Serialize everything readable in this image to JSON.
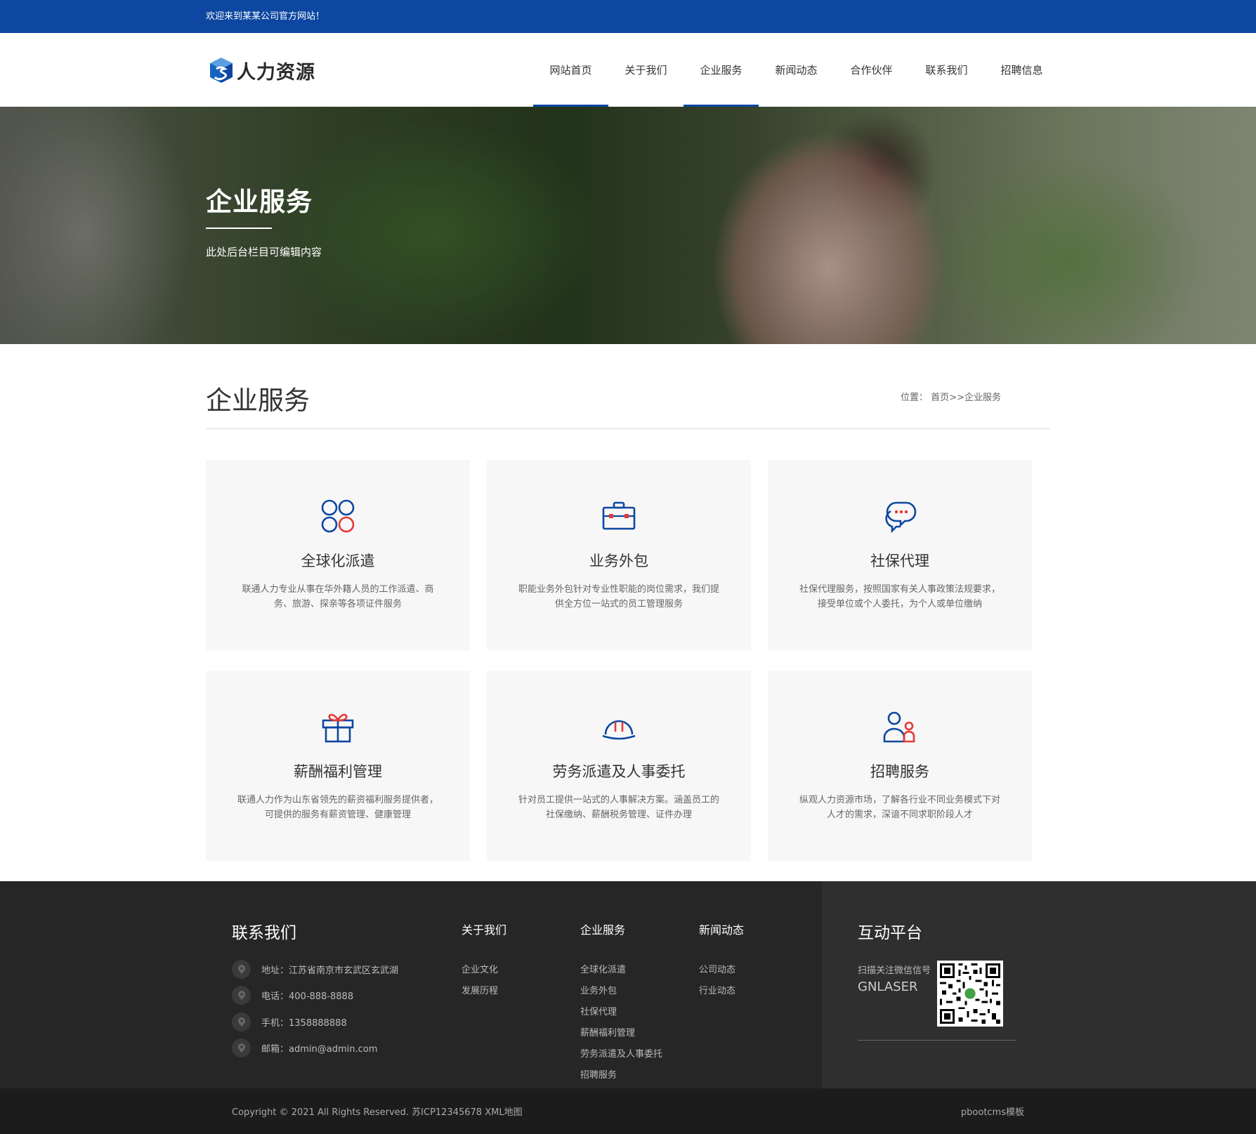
{
  "topbar": {
    "welcome": "欢迎来到某某公司官方网站！"
  },
  "header": {
    "logo_text": "人力资源",
    "nav": [
      {
        "label": "网站首页",
        "active": true
      },
      {
        "label": "关于我们",
        "active": false
      },
      {
        "label": "企业服务",
        "active": true
      },
      {
        "label": "新闻动态",
        "active": false
      },
      {
        "label": "合作伙伴",
        "active": false
      },
      {
        "label": "联系我们",
        "active": false
      },
      {
        "label": "招聘信息",
        "active": false
      }
    ]
  },
  "banner": {
    "title": "企业服务",
    "subtitle": "此处后台栏目可编辑内容"
  },
  "section": {
    "title": "企业服务",
    "breadcrumb_label": "位置：",
    "breadcrumb_home": "首页",
    "breadcrumb_sep": ">>",
    "breadcrumb_current": "企业服务"
  },
  "services": [
    {
      "icon": "clover-icon",
      "title": "全球化派遣",
      "desc": "联通人力专业从事在华外籍人员的工作派遣、商务、旅游、探亲等各项证件服务"
    },
    {
      "icon": "briefcase-icon",
      "title": "业务外包",
      "desc": "职能业务外包针对专业性职能的岗位需求，我们提供全方位一站式的员工管理服务"
    },
    {
      "icon": "chat-bubbles-icon",
      "title": "社保代理",
      "desc": "社保代理服务，按照国家有关人事政策法规要求，接受单位或个人委托，为个人或单位缴纳"
    },
    {
      "icon": "gift-icon",
      "title": "薪酬福利管理",
      "desc": "联通人力作为山东省领先的薪资福利服务提供者，可提供的服务有薪资管理、健康管理"
    },
    {
      "icon": "hard-hat-icon",
      "title": "劳务派遣及人事委托",
      "desc": "针对员工提供一站式的人事解决方案。涵盖员工的社保缴纳、薪酬税务管理、证件办理"
    },
    {
      "icon": "people-icon",
      "title": "招聘服务",
      "desc": "纵观人力资源市场，了解各行业不同业务模式下对人才的需求，深谙不同求职阶段人才"
    }
  ],
  "footer": {
    "contact_title": "联系我们",
    "contacts": [
      "地址：江苏省南京市玄武区玄武湖",
      "电话：400-888-8888",
      "手机：1358888888",
      "邮箱：admin@admin.com"
    ],
    "columns": [
      {
        "title": "关于我们",
        "links": [
          "企业文化",
          "发展历程"
        ]
      },
      {
        "title": "企业服务",
        "links": [
          "全球化派遣",
          "业务外包",
          "社保代理",
          "薪酬福利管理",
          "劳务派遣及人事委托",
          "招聘服务"
        ]
      },
      {
        "title": "新闻动态",
        "links": [
          "公司动态",
          "行业动态"
        ]
      }
    ],
    "interactive_title": "互动平台",
    "wechat_label": "扫描关注微信信号",
    "wechat_id": "GNLASER"
  },
  "bottom": {
    "copyright": "Copyright © 2021 All Rights Reserved. 苏ICP12345678",
    "sitemap": "XML地图",
    "template": "pbootcms模板"
  },
  "colors": {
    "brand_blue": "#0d47a1",
    "accent_red": "#e53935",
    "footer_bg": "#262626"
  }
}
